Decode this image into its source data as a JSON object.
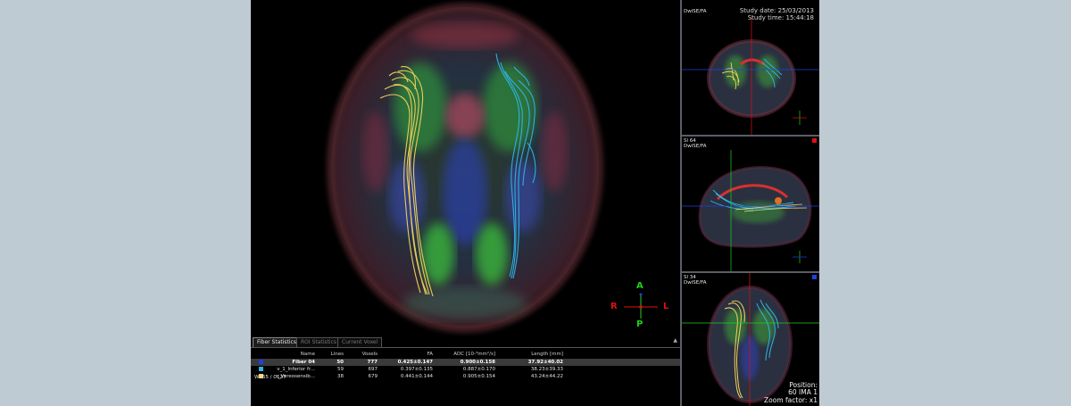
{
  "colors": {
    "accent_red": "#e01010",
    "accent_green": "#1fd11f",
    "accent_blue": "#2040e0",
    "fiber_yellow": "#f4d35a",
    "fiber_cyan": "#2fb4e8"
  },
  "main_view": {
    "orientation": {
      "a": "A",
      "p": "P",
      "r": "R",
      "l": "L"
    }
  },
  "side_views": {
    "coronal": {
      "series": "DwiSE/FA",
      "study_date_label": "Study date:",
      "study_date_value": "25/03/2013",
      "study_time_label": "Study time:",
      "study_time_value": "15:44:18"
    },
    "sagittal": {
      "slice": "Sl 64",
      "series": "DwiSE/FA"
    },
    "axial": {
      "slice": "Sl 34",
      "series": "DwiSE/FA",
      "position_label": "Position:",
      "position_value": "60 IMA 1",
      "zoom_label": "Zoom factor: x1"
    }
  },
  "panel": {
    "tabs": [
      {
        "label": "Fiber Statistics",
        "active": true
      },
      {
        "label": "ROI Statistics",
        "active": false
      },
      {
        "label": "Current Voxel",
        "active": false
      }
    ],
    "collapse_glyph": "▲",
    "columns": [
      "Name",
      "Lines",
      "Voxels",
      "FA",
      "ADC  [10-³mm²/s]",
      "Length [mm]"
    ],
    "rows": [
      {
        "color": "#2040e0",
        "name": "Fiber 04",
        "lines": "50",
        "voxels": "777",
        "fa": "0.425±0.147",
        "adc": "0.900±0.158",
        "length": "37.92±40.02",
        "selected": true
      },
      {
        "color": "#2fb4e8",
        "name": "v_1_Inferior fr...",
        "lines": "59",
        "voxels": "697",
        "fa": "0.397±0.135",
        "adc": "0.887±0.170",
        "length": "38.23±39.33",
        "selected": false
      },
      {
        "color": "#f4d35a",
        "name": "v_Vereosensib...",
        "lines": "38",
        "voxels": "679",
        "fa": "0.441±0.144",
        "adc": "0.905±0.154",
        "length": "43.24±44.22",
        "selected": false
      }
    ],
    "overlay_text": "W255 / C127"
  }
}
